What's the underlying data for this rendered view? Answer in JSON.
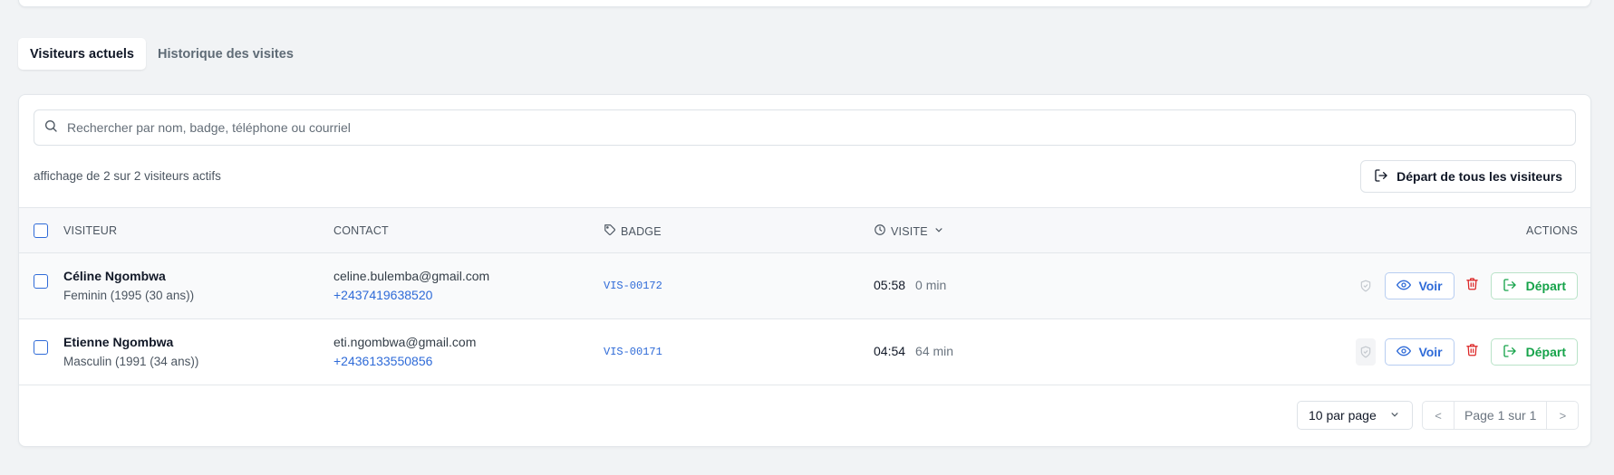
{
  "tabs": [
    {
      "label": "Visiteurs actuels",
      "active": true
    },
    {
      "label": "Historique des visites",
      "active": false
    }
  ],
  "search": {
    "placeholder": "Rechercher par nom, badge, téléphone ou courriel"
  },
  "summary": {
    "count_text": "affichage de 2 sur 2 visiteurs actifs"
  },
  "toolbar": {
    "depart_all_label": "Départ de tous les visiteurs"
  },
  "table": {
    "headers": {
      "visitor": "VISITEUR",
      "contact": "CONTACT",
      "badge": "BADGE",
      "visit": "VISITE",
      "actions": "ACTIONS"
    },
    "rows": [
      {
        "name": "Céline Ngombwa",
        "details": "Feminin (1995 (30 ans))",
        "email": "celine.bulemba@gmail.com",
        "phone": "+2437419638520",
        "badge": "VIS-00172",
        "time": "05:58",
        "duration": "0 min",
        "view_label": "Voir",
        "depart_label": "Départ"
      },
      {
        "name": "Etienne Ngombwa",
        "details": "Masculin (1991 (34 ans))",
        "email": "eti.ngombwa@gmail.com",
        "phone": "+2436133550856",
        "badge": "VIS-00171",
        "time": "04:54",
        "duration": "64 min",
        "view_label": "Voir",
        "depart_label": "Départ"
      }
    ]
  },
  "pagination": {
    "per_page": "10 par page",
    "prev": "<",
    "page_label": "Page 1 sur 1",
    "next": ">"
  },
  "colors": {
    "accent": "#2f6bd8",
    "success": "#16a34a",
    "danger": "#dc2626",
    "background": "#f1f3f5"
  },
  "icons": [
    "search-icon",
    "logout-icon",
    "tag-icon",
    "clock-icon",
    "chevron-down-icon",
    "shield-check-icon",
    "eye-icon",
    "trash-icon"
  ]
}
